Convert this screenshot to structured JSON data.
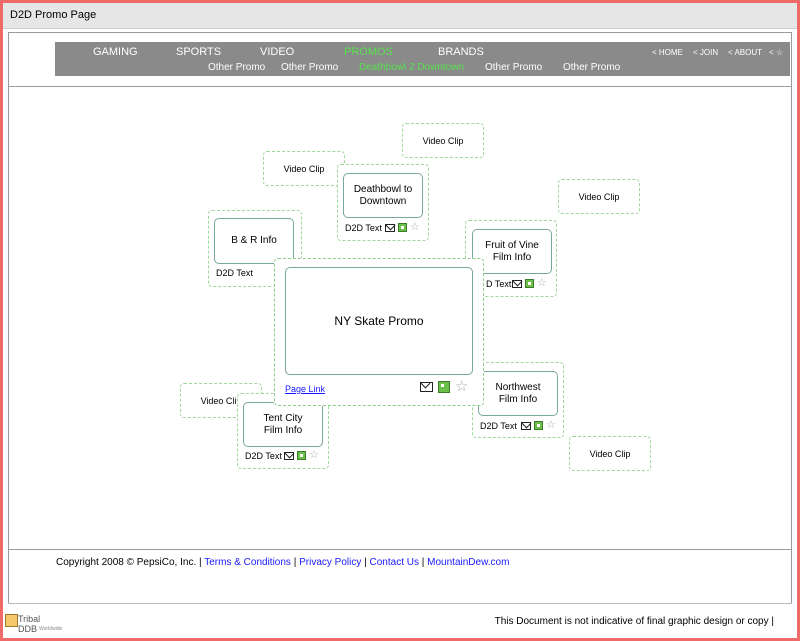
{
  "window": {
    "title": "D2D Promo Page"
  },
  "nav": {
    "main": [
      "GAMING",
      "SPORTS",
      "VIDEO",
      "PROMOS",
      "BRANDS"
    ],
    "sub": [
      "Other Promo",
      "Other Promo",
      "Deathbowl 2 Downtown",
      "Other Promo",
      "Other Promo"
    ],
    "util": [
      "< HOME",
      "< JOIN",
      "< ABOUT",
      "<"
    ]
  },
  "promos": {
    "main": {
      "title": "NY Skate Promo",
      "link": "Page Link"
    },
    "deathbowl": {
      "title_l1": "Deathbowl to",
      "title_l2": "Downtown",
      "caption": "D2D Text"
    },
    "br": {
      "title": "B & R Info",
      "caption": "D2D Text"
    },
    "fruit": {
      "title_l1": "Fruit of Vine",
      "title_l2": "Film Info",
      "caption": "D Text"
    },
    "northwest": {
      "title_l1": "Northwest",
      "title_l2": "Film Info",
      "caption": "D2D Text"
    },
    "tent": {
      "title_l1": "Tent City",
      "title_l2": "Film Info",
      "caption": "D2D Text"
    },
    "clip": "Video Clip"
  },
  "footer": {
    "copyright": "Copyright 2008 © PepsiCo, Inc. |",
    "terms": "Terms & Conditions",
    "privacy": "Privacy Policy",
    "contact": "Contact Us",
    "site": "MountainDew.com",
    "sep": "|"
  },
  "disclaimer": "This Document is not indicative of  final graphic design or copy |",
  "logo": {
    "name": "Tribal DDB",
    "sub": "Worldwide"
  }
}
